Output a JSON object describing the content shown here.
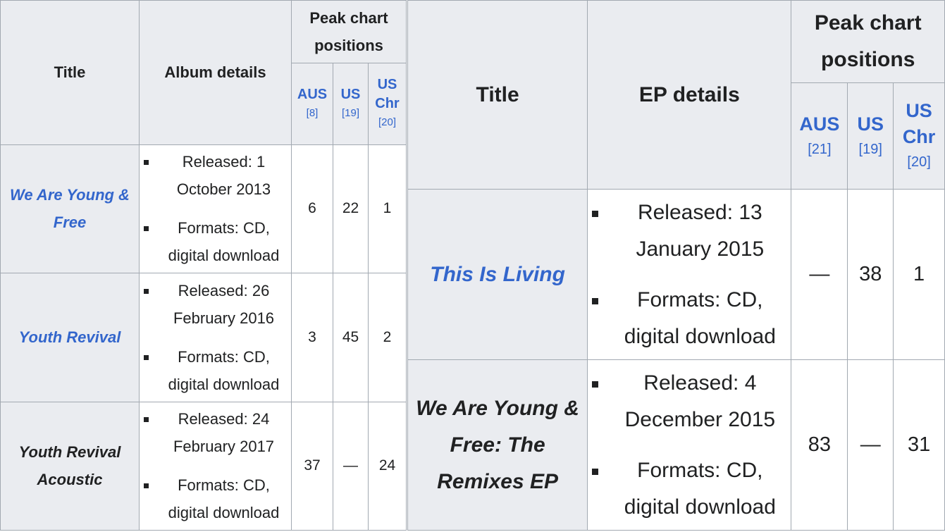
{
  "albums_table": {
    "headers": {
      "title": "Title",
      "details": "Album details",
      "peak": "Peak chart positions",
      "charts": [
        {
          "name": "AUS",
          "ref": "[8]"
        },
        {
          "name": "US",
          "ref": "[19]"
        },
        {
          "name": "US Chr",
          "ref": "[20]"
        }
      ]
    },
    "rows": [
      {
        "title": "We Are Young & Free",
        "linked": true,
        "released": "Released: 1 October 2013",
        "formats": "Formats: CD, digital download",
        "positions": [
          "6",
          "22",
          "1"
        ]
      },
      {
        "title": "Youth Revival",
        "linked": true,
        "released": "Released: 26 February 2016",
        "formats": "Formats: CD, digital download",
        "positions": [
          "3",
          "45",
          "2"
        ]
      },
      {
        "title": "Youth Revival Acoustic",
        "linked": false,
        "released": "Released: 24 February 2017",
        "formats": "Formats: CD, digital download",
        "positions": [
          "37",
          "—",
          "24"
        ]
      }
    ]
  },
  "eps_table": {
    "headers": {
      "title": "Title",
      "details": "EP details",
      "peak": "Peak chart positions",
      "charts": [
        {
          "name": "AUS",
          "ref": "[21]"
        },
        {
          "name": "US",
          "ref": "[19]"
        },
        {
          "name": "US Chr",
          "ref": "[20]"
        }
      ]
    },
    "rows": [
      {
        "title": "This Is Living",
        "linked": true,
        "released": "Released: 13 January 2015",
        "formats": "Formats: CD, digital download",
        "positions": [
          "—",
          "38",
          "1"
        ]
      },
      {
        "title": "We Are Young & Free: The Remixes EP",
        "linked": false,
        "released": "Released: 4 December 2015",
        "formats": "Formats: CD, digital download",
        "positions": [
          "83",
          "—",
          "31"
        ]
      }
    ]
  },
  "colors": {
    "link": "#3366cc",
    "header_bg": "#eaecf0",
    "border": "#a2a9b1",
    "text": "#202122"
  }
}
